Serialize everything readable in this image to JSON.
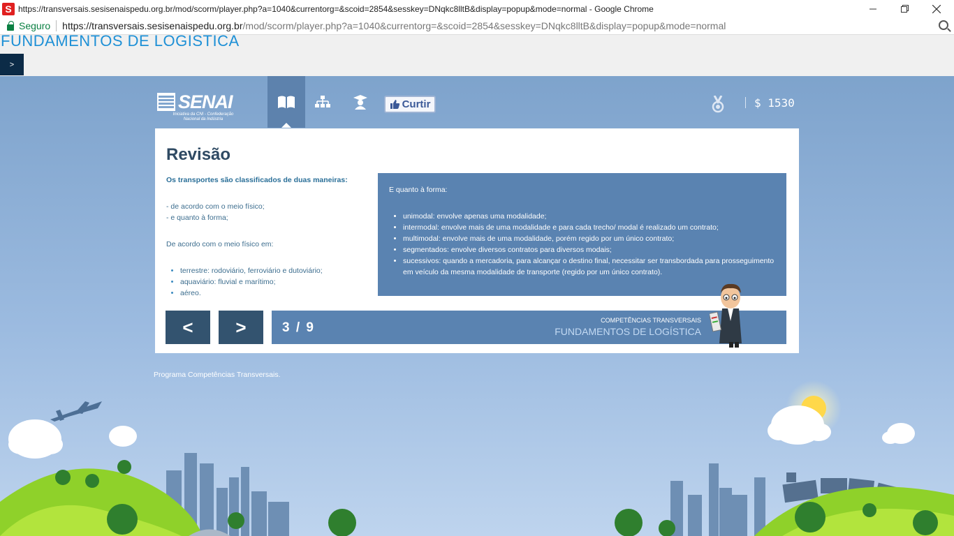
{
  "browser": {
    "window_title": "https://transversais.sesisenaispedu.org.br/mod/scorm/player.php?a=1040&currentorg=&scoid=2854&sesskey=DNqkc8lltB&display=popup&mode=normal - Google Chrome",
    "favicon_letter": "S",
    "secure_label": "Seguro",
    "url_host": "https://transversais.sesisenaispedu.org.br",
    "url_path": "/mod/scorm/player.php?a=1040&currentorg=&scoid=2854&sesskey=DNqkc8lltB&display=popup&mode=normal",
    "minimize_icon": "minimize-icon",
    "restore_icon": "restore-icon",
    "close_icon": "close-icon"
  },
  "header": {
    "course_title": "FUNDAMENTOS DE LOGÍSTICA",
    "toggle_label": ">"
  },
  "toolbar": {
    "logo_text": "SENAI",
    "logo_sub_line1": "Iniciativa da CNI - Confederação",
    "logo_sub_line2": "Nacional da Indústria",
    "nav_icons": [
      "book-icon",
      "sitemap-icon",
      "graduate-icon"
    ],
    "curtir_label": "Curtir",
    "score": "$ 1530"
  },
  "content": {
    "title": "Revisão",
    "lead": "Os transportes são classificados de duas maneiras:",
    "ways": [
      "- de acordo com o meio físico;",
      "- e quanto à forma;"
    ],
    "physical_intro": "De acordo com o meio físico em:",
    "physical_items": [
      "terrestre: rodoviário, ferroviário e dutoviário;",
      "aquaviário: fluvial e marítimo;",
      "aéreo."
    ],
    "form_intro": "E quanto à forma:",
    "form_items": [
      "unimodal: envolve apenas uma modalidade;",
      "intermodal: envolve mais de uma modalidade e para cada trecho/ modal é realizado um contrato;",
      "multimodal: envolve mais de uma modalidade, porém regido por um único contrato;",
      "segmentados: envolve diversos contratos para diversos modais;",
      "sucessivos: quando a mercadoria, para alcançar o destino final, necessitar ser transbordada para prosseguimento em veículo da mesma modalidade de transporte (regido por um único contrato)."
    ]
  },
  "navigation": {
    "prev_label": "<",
    "next_label": ">",
    "page_indicator": "3 / 9",
    "program_label": "COMPETÊNCIAS TRANSVERSAIS",
    "course_label": "FUNDAMENTOS DE LOGÍSTICA"
  },
  "footer": {
    "text": "Programa Competências Transversais."
  },
  "colors": {
    "panel_blue": "#5a83b1",
    "dark_button": "#33536f",
    "title_link": "#1e90d6"
  }
}
